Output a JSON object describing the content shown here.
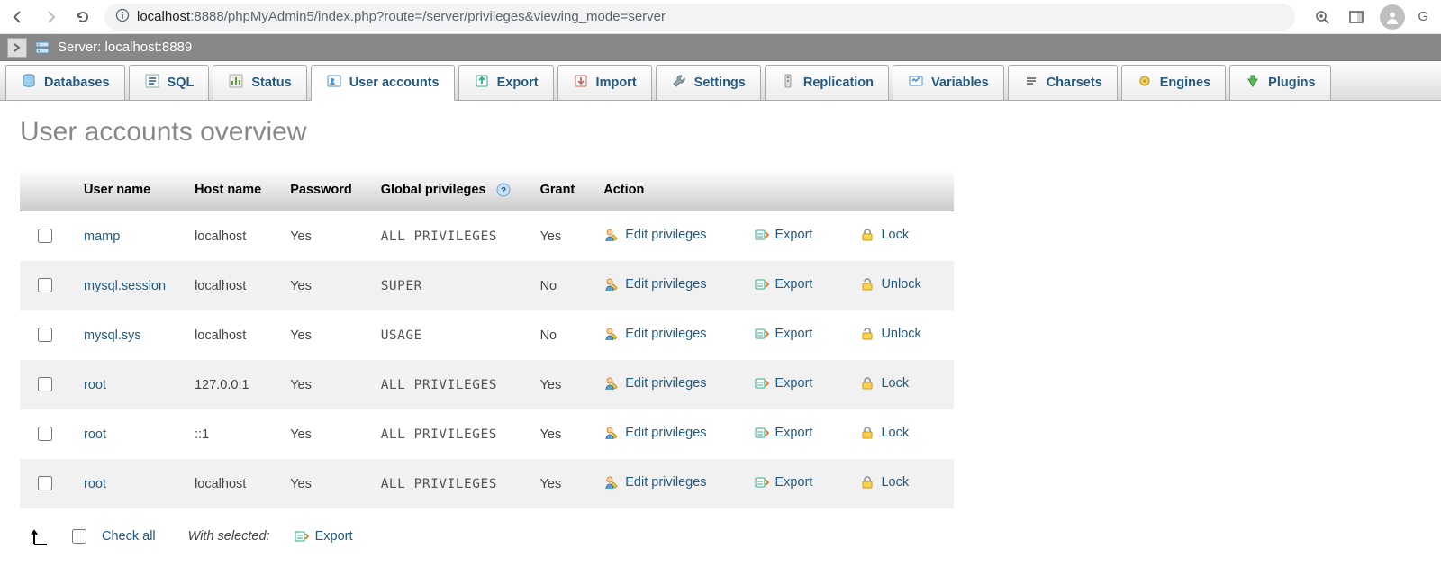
{
  "browser": {
    "url_prefix": "localhost",
    "url_rest": ":8888/phpMyAdmin5/index.php?route=/server/privileges&viewing_mode=server",
    "profile_initial": "G"
  },
  "server_bar": {
    "label_prefix": "Server:",
    "server": "localhost:8889"
  },
  "tabs": [
    {
      "label": "Databases",
      "icon": "database"
    },
    {
      "label": "SQL",
      "icon": "sql"
    },
    {
      "label": "Status",
      "icon": "status"
    },
    {
      "label": "User accounts",
      "icon": "users",
      "active": true
    },
    {
      "label": "Export",
      "icon": "export"
    },
    {
      "label": "Import",
      "icon": "import"
    },
    {
      "label": "Settings",
      "icon": "wrench"
    },
    {
      "label": "Replication",
      "icon": "replication"
    },
    {
      "label": "Variables",
      "icon": "variables"
    },
    {
      "label": "Charsets",
      "icon": "charsets"
    },
    {
      "label": "Engines",
      "icon": "engines"
    },
    {
      "label": "Plugins",
      "icon": "plugins"
    }
  ],
  "page_title": "User accounts overview",
  "columns": {
    "username": "User name",
    "hostname": "Host name",
    "password": "Password",
    "globalpriv": "Global privileges",
    "grant": "Grant",
    "action": "Action"
  },
  "action_labels": {
    "edit": "Edit privileges",
    "export": "Export",
    "lock": "Lock",
    "unlock": "Unlock"
  },
  "users": [
    {
      "username": "mamp",
      "host": "localhost",
      "password": "Yes",
      "privileges": "ALL PRIVILEGES",
      "grant": "Yes",
      "lock_state": "lock"
    },
    {
      "username": "mysql.session",
      "host": "localhost",
      "password": "Yes",
      "privileges": "SUPER",
      "grant": "No",
      "lock_state": "unlock"
    },
    {
      "username": "mysql.sys",
      "host": "localhost",
      "password": "Yes",
      "privileges": "USAGE",
      "grant": "No",
      "lock_state": "unlock"
    },
    {
      "username": "root",
      "host": "127.0.0.1",
      "password": "Yes",
      "privileges": "ALL PRIVILEGES",
      "grant": "Yes",
      "lock_state": "lock"
    },
    {
      "username": "root",
      "host": "::1",
      "password": "Yes",
      "privileges": "ALL PRIVILEGES",
      "grant": "Yes",
      "lock_state": "lock"
    },
    {
      "username": "root",
      "host": "localhost",
      "password": "Yes",
      "privileges": "ALL PRIVILEGES",
      "grant": "Yes",
      "lock_state": "lock"
    }
  ],
  "footer": {
    "check_all": "Check all",
    "with_selected": "With selected:",
    "export": "Export"
  }
}
